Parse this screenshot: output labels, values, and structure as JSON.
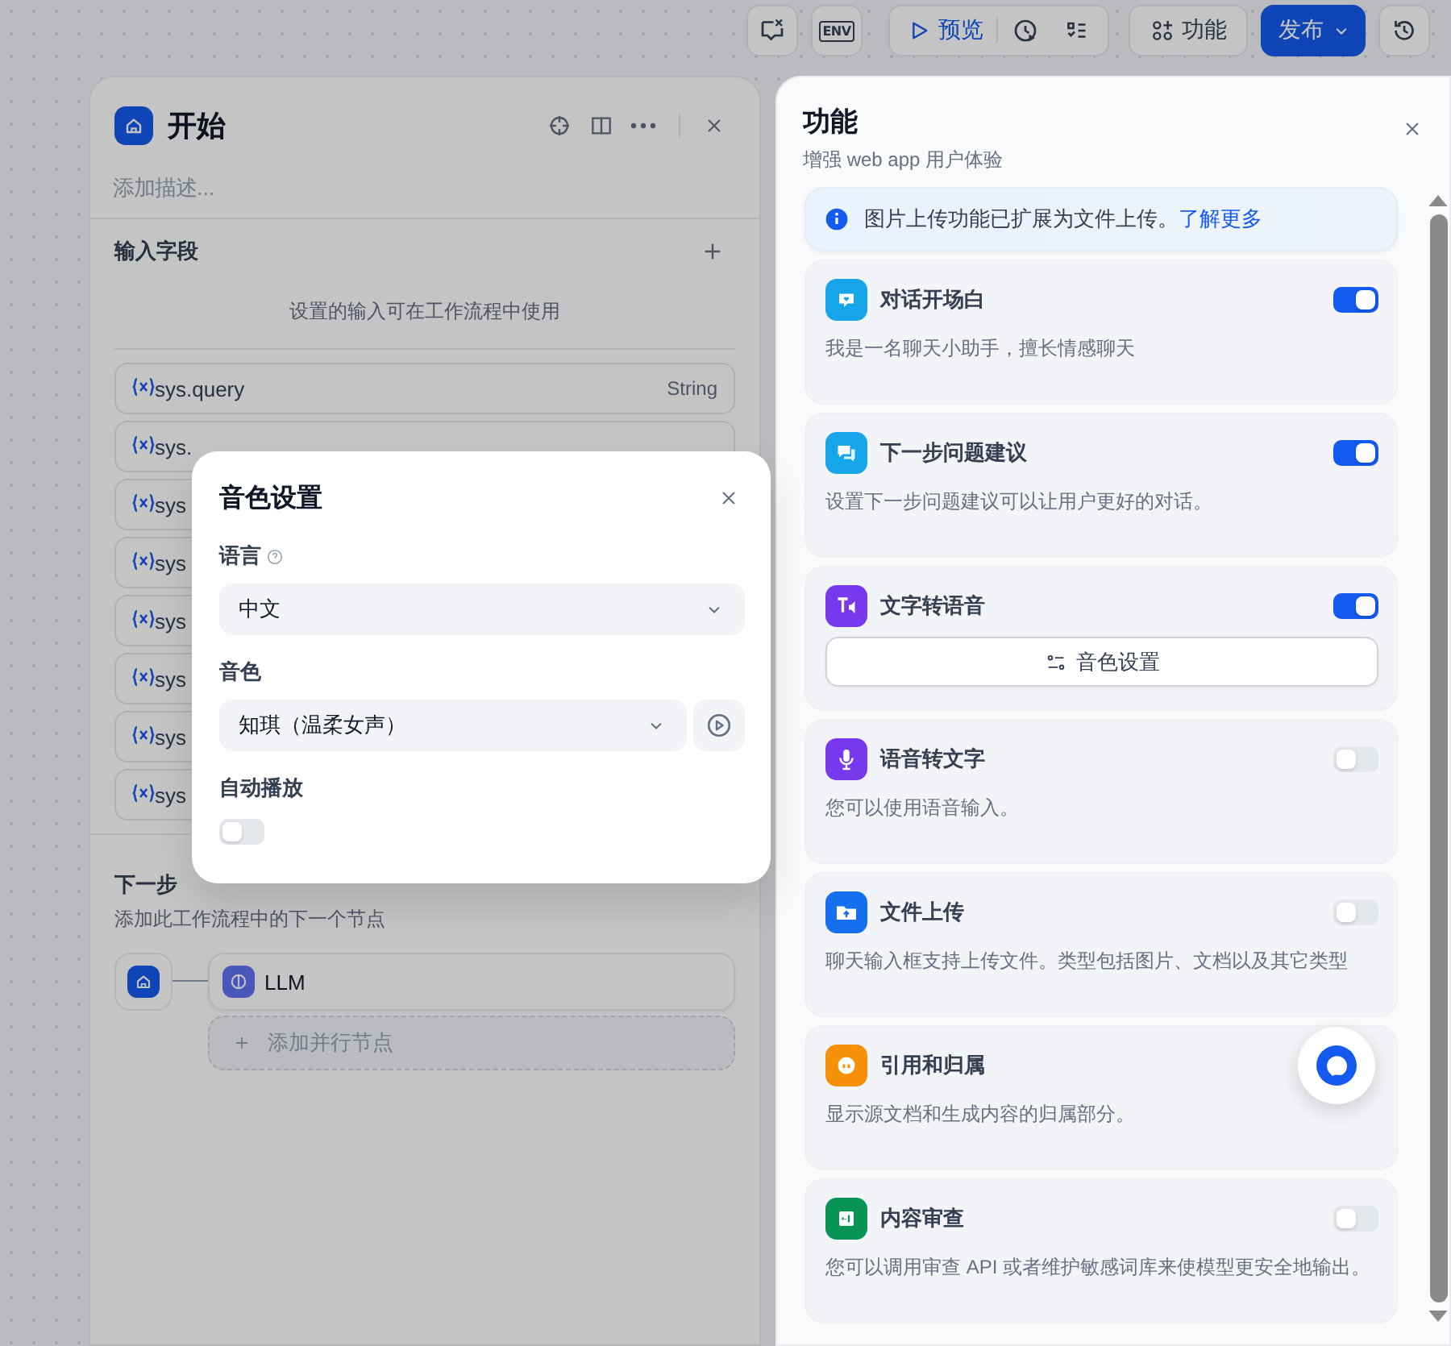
{
  "toolbar": {
    "env_label": "ENV",
    "preview": "预览",
    "features": "功能",
    "publish": "发布"
  },
  "start_panel": {
    "title": "开始",
    "description_placeholder": "添加描述...",
    "input_section": "输入字段",
    "input_hint": "设置的输入可在工作流程中使用",
    "variables": [
      {
        "name": "sys.query",
        "type": "String"
      },
      {
        "name": "sys."
      },
      {
        "name": "sys"
      },
      {
        "name": "sys"
      },
      {
        "name": "sys"
      },
      {
        "name": "sys"
      },
      {
        "name": "sys"
      },
      {
        "name": "sys"
      }
    ],
    "next_step": {
      "title": "下一步",
      "hint": "添加此工作流程中的下一个节点",
      "node": "LLM",
      "add_parallel": "添加并行节点"
    }
  },
  "voice_dialog": {
    "title": "音色设置",
    "language_label": "语言",
    "language": "中文",
    "voice_label": "音色",
    "voice": "知琪（温柔女声）",
    "autoplay_label": "自动播放",
    "autoplay": false
  },
  "features_panel": {
    "title": "功能",
    "subtitle": "增强 web app 用户体验",
    "notice": "图片上传功能已扩展为文件上传。",
    "notice_link": "了解更多",
    "features": [
      {
        "kind": "toggle",
        "color": "#16a5e8",
        "title": "对话开场白",
        "description": "我是一名聊天小助手，擅长情感聊天",
        "on": true
      },
      {
        "kind": "toggle",
        "color": "#16a5e8",
        "title": "下一步问题建议",
        "description": "设置下一步问题建议可以让用户更好的对话。",
        "on": true
      },
      {
        "kind": "button",
        "color": "#7839ee",
        "title": "文字转语音",
        "button": "音色设置",
        "on": true
      },
      {
        "kind": "toggle",
        "color": "#7839ee",
        "title": "语音转文字",
        "description": "您可以使用语音输入。",
        "on": false
      },
      {
        "kind": "toggle",
        "color": "#1570ef",
        "title": "文件上传",
        "description": "聊天输入框支持上传文件。类型包括图片、文档以及其它类型",
        "on": false
      },
      {
        "kind": "toggle",
        "color": "#f79009",
        "title": "引用和归属",
        "description": "显示源文档和生成内容的归属部分。"
      },
      {
        "kind": "toggle",
        "color": "#079455",
        "title": "内容审查",
        "description": "您可以调用审查 API 或者维护敏感词库来使模型更安全地输出。",
        "on": false
      }
    ]
  }
}
